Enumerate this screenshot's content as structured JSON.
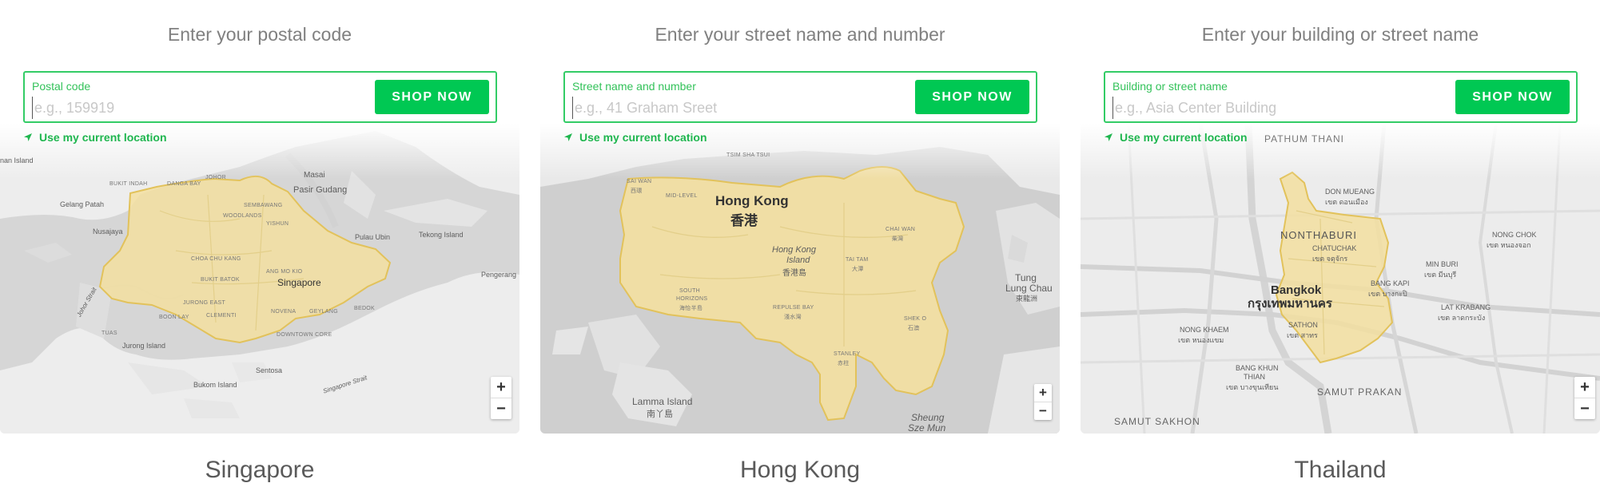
{
  "panels": [
    {
      "heading": "Enter your postal code",
      "field_label": "Postal code",
      "placeholder": "e.g., 159919",
      "button_label": "SHOP NOW",
      "location_link": "Use my current location",
      "country": "Singapore",
      "map_labels": {
        "l1": "Masai",
        "l2": "Pasir Gudang",
        "l3": "BUKIT INDAH",
        "l4": "DANGA BAY",
        "l5": "JOHOR",
        "l6": "Gelang Patah",
        "l7": "Nusajaya",
        "l8": "Pulau Ubin",
        "l9": "Tekong Island",
        "l10": "Singapore",
        "l11": "Pengerang",
        "l12": "Jurong Island",
        "l13": "Bukom Island",
        "l14": "Sentosa",
        "l15": "Singapore Strait",
        "l16": "WOODLANDS",
        "l17": "SEMBAWANG",
        "l18": "YISHUN",
        "l19": "CHOA CHU KANG",
        "l20": "BUKIT BATOK",
        "l21": "ANG MO KIO",
        "l22": "JURONG EAST",
        "l23": "CLEMENTI",
        "l24": "BOON LAY",
        "l25": "NOVENA",
        "l26": "GEYLANG",
        "l27": "BEDOK",
        "l28": "DOWNTOWN CORE",
        "l29": "TUAS",
        "l30": "nan Island",
        "l31": "Johor Strait"
      }
    },
    {
      "heading": "Enter your street name and number",
      "field_label": "Street name and number",
      "placeholder": "e.g., 41 Graham Sreet",
      "button_label": "SHOP NOW",
      "location_link": "Use my current location",
      "country": "Hong Kong",
      "map_labels": {
        "l1": "Hong Kong",
        "l2": "香港",
        "l3": "Hong Kong",
        "l4": "Island",
        "l5": "香港島",
        "l6": "Tung",
        "l7": "Lung Chau",
        "l8": "東龍洲",
        "l9": "Lamma Island",
        "l10": "南丫島",
        "l11": "Sheung",
        "l12": "Sze Mun",
        "l13": "SAI WAN",
        "l14": "西環",
        "l15": "MID-LEVEL",
        "l16": "SOUTH",
        "l17": "HORIZONS",
        "l18": "海怡半島",
        "l19": "REPULSE BAY",
        "l20": "淺水灣",
        "l21": "STANLEY",
        "l22": "赤柱",
        "l23": "CHAI WAN",
        "l24": "柴灣",
        "l25": "TAI TAM",
        "l26": "大潭",
        "l27": "SHEK O",
        "l28": "石澳",
        "l29": "TSIM SHA TSUI"
      }
    },
    {
      "heading": "Enter your building or street name",
      "field_label": "Building or street name",
      "placeholder": "e.g., Asia Center Building",
      "button_label": "SHOP NOW",
      "location_link": "Use my current location",
      "country": "Thailand",
      "map_labels": {
        "l1": "PATHUM THANI",
        "l2": "DON MUEANG",
        "l3": "เขต ดอนเมือง",
        "l4": "NONTHABURI",
        "l5": "CHATUCHAK",
        "l6": "เขต จตุจักร",
        "l7": "NONG CHOK",
        "l8": "เขต หนองจอก",
        "l9": "MIN BURI",
        "l10": "เขต มีนบุรี",
        "l11": "BANG KAPI",
        "l12": "เขต บางกะปิ",
        "l13": "Bangkok",
        "l14": "กรุงเทพมหานคร",
        "l15": "LAT KRABANG",
        "l16": "เขต ลาดกระบัง",
        "l17": "NONG KHAEM",
        "l18": "เขต หนองแขม",
        "l19": "SATHON",
        "l20": "เขต สาทร",
        "l21": "BANG KHUN",
        "l22": "THIAN",
        "l23": "เขต บางขุนเทียน",
        "l24": "SAMUT PRAKAN",
        "l25": "SAMUT SAKHON"
      }
    }
  ],
  "zoom": {
    "in": "+",
    "out": "−"
  },
  "colors": {
    "accent_green": "#00c853",
    "border_green": "#33cc66",
    "area_fill": "#f3dfa0",
    "area_stroke": "#e2c25b",
    "land": "#eeeeee",
    "water_hk": "#cfcfcf"
  },
  "icons": {
    "location": "navigation-arrow-icon"
  }
}
